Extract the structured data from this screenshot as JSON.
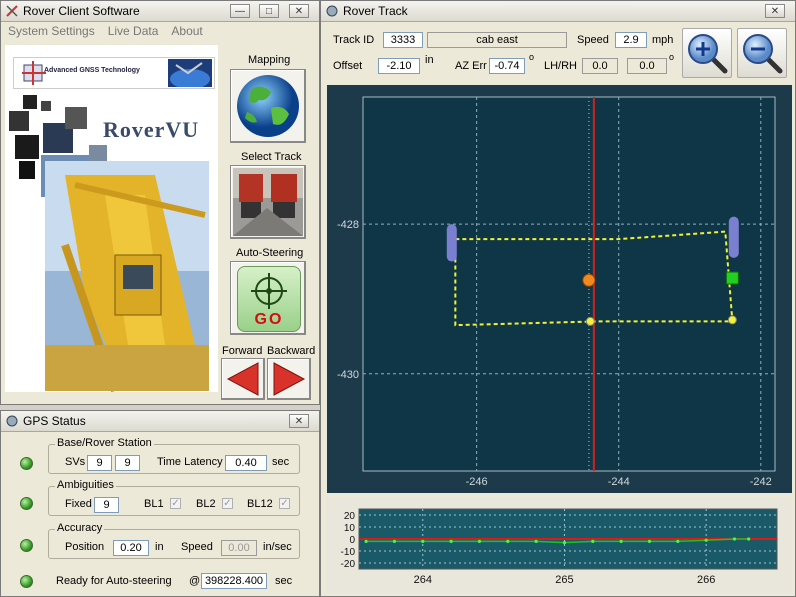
{
  "client_window": {
    "title": "Rover Client Software",
    "menu": [
      "System Settings",
      "Live Data",
      "About"
    ],
    "logo": {
      "tagline": "Advanced GNSS Technology",
      "product_name": "RoverVU"
    },
    "buttons": {
      "mapping": "Mapping",
      "select_track": "Select Track",
      "auto_steering": "Auto-Steering",
      "go": "GO",
      "forward": "Forward",
      "backward": "Backward"
    }
  },
  "gps_window": {
    "title": "GPS Status",
    "base_rover": {
      "group_label": "Base/Rover Station",
      "svs_label": "SVs",
      "svs_base": "9",
      "svs_rover": "9",
      "latency_label": "Time Latency",
      "latency_value": "0.40",
      "latency_unit": "sec"
    },
    "ambiguities": {
      "group_label": "Ambiguities",
      "fixed_label": "Fixed",
      "fixed_value": "9",
      "bl1": "BL1",
      "bl2": "BL2",
      "bl12": "BL12"
    },
    "accuracy": {
      "group_label": "Accuracy",
      "position_label": "Position",
      "position_value": "0.20",
      "position_unit": "in",
      "speed_label": "Speed",
      "speed_value": "0.00",
      "speed_unit": "in/sec"
    },
    "ready": {
      "label": "Ready for Auto-steering",
      "at": "@",
      "value": "398228.400",
      "unit": "sec"
    }
  },
  "track_window": {
    "title": "Rover Track",
    "track_id_label": "Track ID",
    "track_id": "3333",
    "track_name": "cab east",
    "speed_label": "Speed",
    "speed_value": "2.9",
    "speed_unit": "mph",
    "offset_label": "Offset",
    "offset_value": "-2.10",
    "offset_unit": "in",
    "az_err_label": "AZ Err",
    "az_err_value": "-0.74",
    "az_err_unit": "o",
    "lhrh_label": "LH/RH",
    "lh_value": "0.0",
    "rh_value": "0.0",
    "lhrh_unit": "o"
  },
  "chart_data": [
    {
      "type": "line",
      "x_ticks": [
        "-246",
        "-244",
        "-242"
      ],
      "y_ticks": [
        "-428",
        "-430"
      ],
      "xlim": [
        -247.6,
        -241.8
      ],
      "ylim": [
        -431.3,
        -426.3
      ],
      "grid": true,
      "track_path": [
        {
          "x": -246.3,
          "y": -428.2
        },
        {
          "x": -244,
          "y": -428.2
        },
        {
          "x": -242.5,
          "y": -428.1
        },
        {
          "x": -242.4,
          "y": -429.3
        },
        {
          "x": -244.3,
          "y": -429.3
        },
        {
          "x": -246.3,
          "y": -429.35
        },
        {
          "x": -246.3,
          "y": -428.25
        }
      ],
      "vertical_line_x": -244.35,
      "guide_line_x": -244.42,
      "rover_marker": {
        "x": -244.42,
        "y": -428.75
      },
      "target_marker": {
        "x": -242.4,
        "y": -428.72
      },
      "corner_markers": [
        {
          "x": -244.4,
          "y": -429.3
        },
        {
          "x": -242.4,
          "y": -429.28
        }
      ],
      "bars": [
        {
          "x": -246.35,
          "y_top": -428.0,
          "y_bottom": -428.5
        },
        {
          "x": -242.38,
          "y_top": -427.9,
          "y_bottom": -428.45
        }
      ]
    },
    {
      "type": "line",
      "x_ticks": [
        "264",
        "265",
        "266"
      ],
      "y_ticks": [
        "20",
        "10",
        "0",
        "-10",
        "-20"
      ],
      "xlim": [
        263.55,
        266.5
      ],
      "ylim": [
        -25,
        25
      ],
      "grid": true,
      "reference_y": 0,
      "series": [
        {
          "x": [
            263.6,
            263.8,
            264.0,
            264.2,
            264.4,
            264.6,
            264.8,
            265.0,
            265.2,
            265.4,
            265.6,
            265.8,
            266.0,
            266.2,
            266.3
          ],
          "y": [
            -2,
            -2,
            -2,
            -2,
            -2,
            -2,
            -2,
            -3,
            -2,
            -2,
            -2,
            -2,
            -1,
            0,
            0
          ]
        }
      ]
    }
  ]
}
